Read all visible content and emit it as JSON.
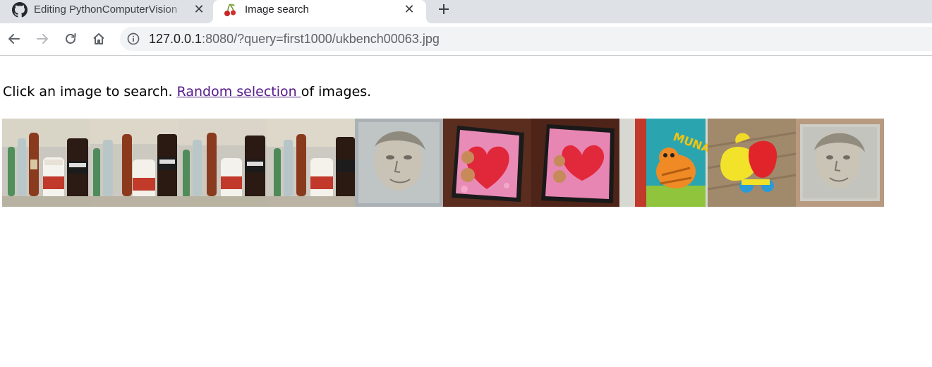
{
  "tabs": [
    {
      "title": "Editing PythonComputerVision",
      "favicon": "github-icon",
      "active": false
    },
    {
      "title": "Image search",
      "favicon": "cherry-icon",
      "active": true
    }
  ],
  "toolbar": {
    "url_host": "127.0.0.1",
    "url_rest": ":8080/?query=first1000/ukbench00063.jpg"
  },
  "page": {
    "intro_before": "Click an image to search. ",
    "link_text": "Random selection ",
    "intro_after": "of images."
  },
  "thumbnails": [
    {
      "subject": "bottles-and-jars"
    },
    {
      "subject": "bottles-and-jars"
    },
    {
      "subject": "bottles-and-jars"
    },
    {
      "subject": "bottles-and-jars"
    },
    {
      "subject": "portrait-drawing"
    },
    {
      "subject": "heart-card"
    },
    {
      "subject": "heart-card"
    },
    {
      "subject": "cat-book"
    },
    {
      "subject": "toy-duck"
    },
    {
      "subject": "portrait-drawing"
    }
  ],
  "colors": {
    "tabstrip": "#dee1e6",
    "link_visited": "#551a8b",
    "omnibox": "#f1f3f4"
  }
}
